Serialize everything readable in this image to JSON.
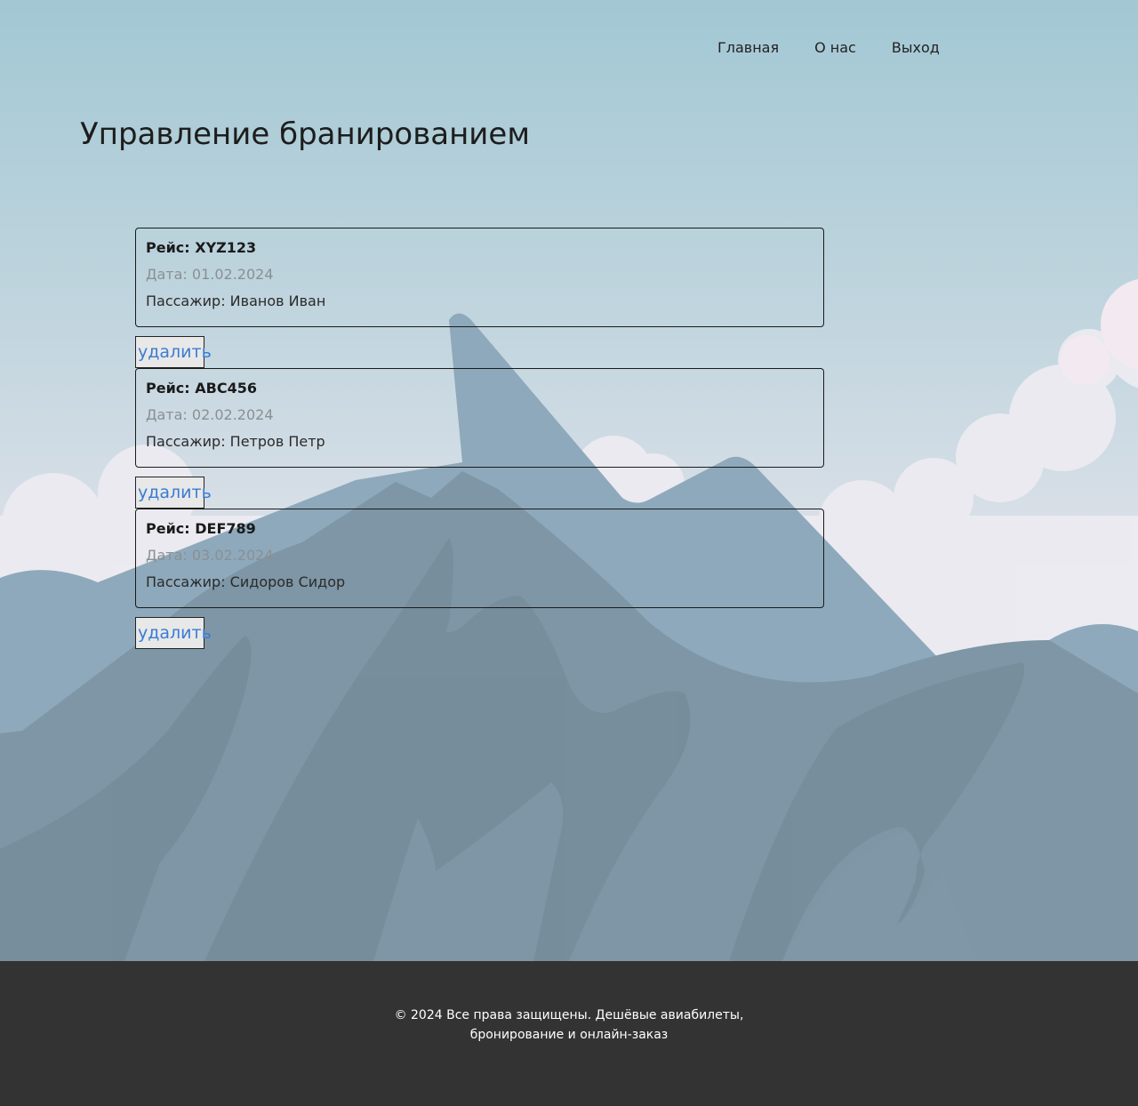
{
  "nav": {
    "items": [
      "Главная",
      "О нас",
      "Выход"
    ]
  },
  "page_title": "Управление бранированием",
  "bookings": [
    {
      "flight": "Рейс: XYZ123",
      "date": "Дата: 01.02.2024",
      "passenger": "Пассажир: Иванов Иван",
      "delete_label": "удалить"
    },
    {
      "flight": "Рейс: ABC456",
      "date": "Дата: 02.02.2024",
      "passenger": "Пассажир: Петров Петр",
      "delete_label": "удалить"
    },
    {
      "flight": "Рейс: DEF789",
      "date": "Дата: 03.02.2024",
      "passenger": "Пассажир: Сидоров Сидор",
      "delete_label": "удалить"
    }
  ],
  "footer": {
    "line1": "© 2024 Все права защищены. Дешёвые авиабилеты,",
    "line2": "бронирование и онлайн-заказ"
  },
  "colors": {
    "sky_top": "#a2c8d4",
    "sky_bottom": "#e6e6ee",
    "mountain_far": "#8ea9bb",
    "mountain_near": "#7b93a2",
    "footer_bg": "#333333",
    "link": "#3a7bd5"
  }
}
